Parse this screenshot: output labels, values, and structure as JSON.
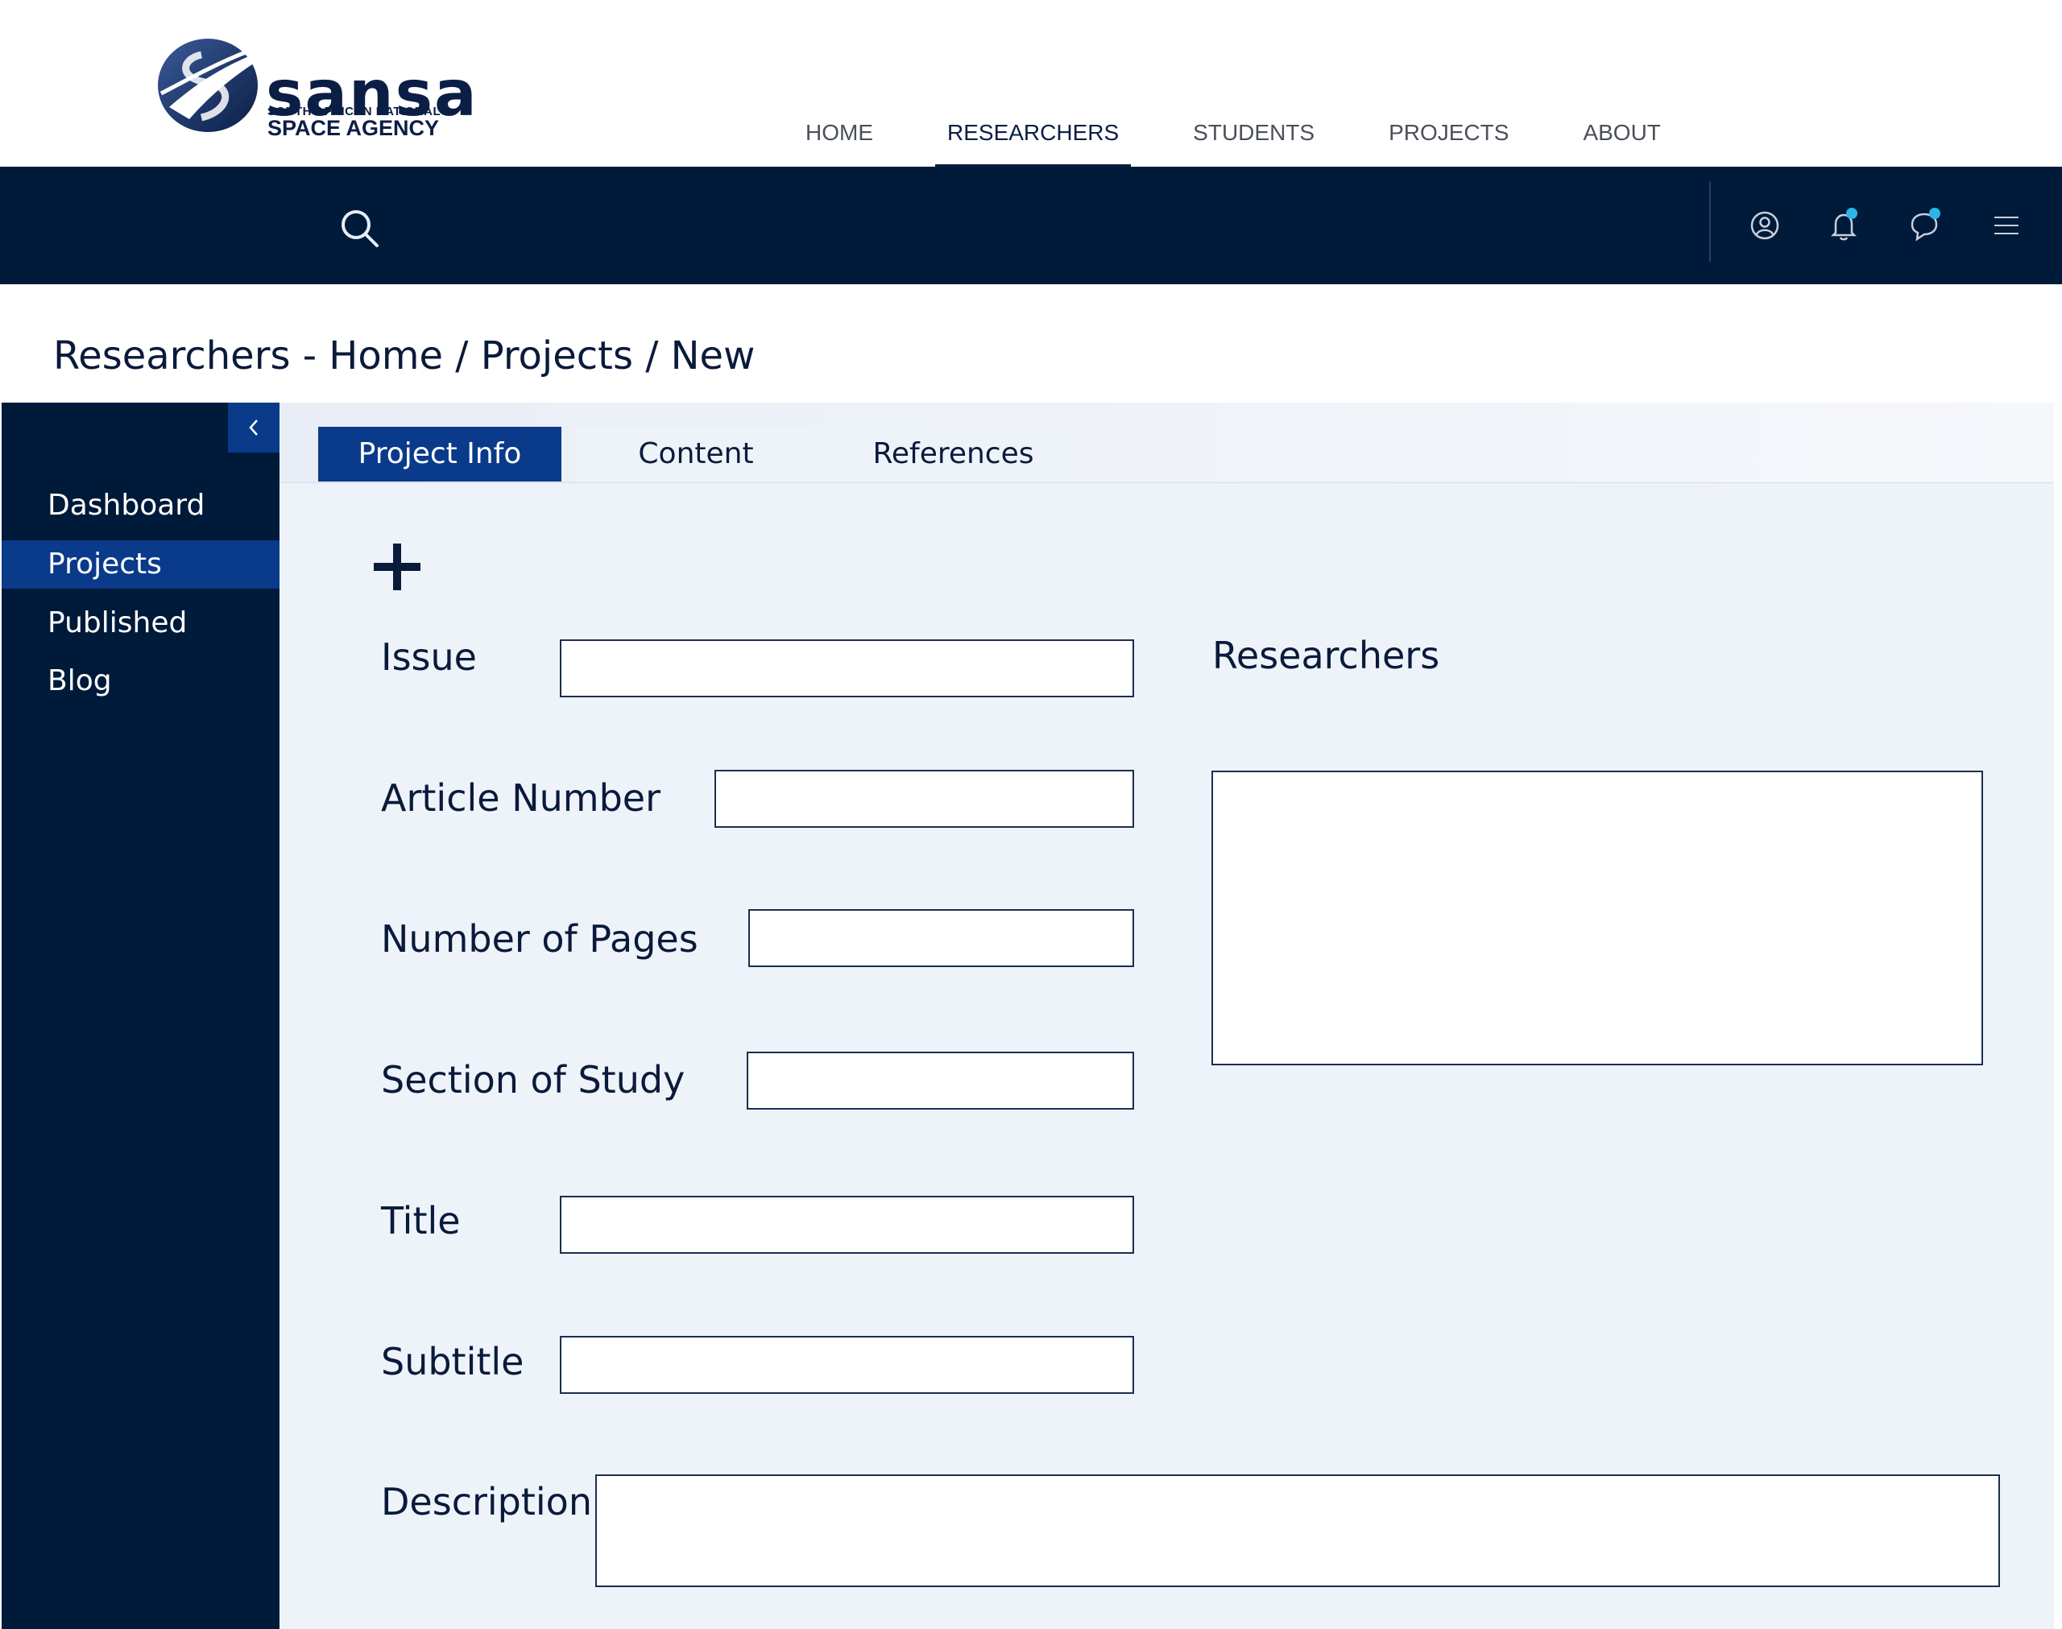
{
  "brand": {
    "wordmark": "sansa",
    "tagline_small": "SOUTH AFRICAN NATIONAL",
    "tagline_large": "SPACE AGENCY",
    "primary_color": "#0b1e45",
    "accent_color": "#2bb5e8"
  },
  "nav": {
    "items": [
      {
        "label": "HOME",
        "active": false
      },
      {
        "label": "RESEARCHERS",
        "active": true
      },
      {
        "label": "STUDENTS",
        "active": false
      },
      {
        "label": "PROJECTS",
        "active": false
      },
      {
        "label": "ABOUT",
        "active": false
      }
    ]
  },
  "toolbar": {
    "background": "#001a3a",
    "search": {
      "value": "",
      "placeholder": ""
    },
    "icons": [
      "user-icon",
      "bell-icon",
      "chat-icon",
      "menu-icon"
    ]
  },
  "page": {
    "title": "Researchers - Home / Projects / New"
  },
  "sidebar": {
    "collapse_icon": "chevron-left-icon",
    "items": [
      {
        "label": "Dashboard",
        "active": false
      },
      {
        "label": "Projects",
        "active": true
      },
      {
        "label": "Published",
        "active": false
      },
      {
        "label": "Blog",
        "active": false
      }
    ]
  },
  "tabs": [
    {
      "label": "Project Info",
      "active": true
    },
    {
      "label": "Content",
      "active": false
    },
    {
      "label": "References",
      "active": false
    }
  ],
  "form": {
    "add_icon": "plus-icon",
    "issue": {
      "label": "Issue",
      "value": ""
    },
    "article_number": {
      "label": "Article Number",
      "value": ""
    },
    "number_of_pages": {
      "label": "Number of Pages",
      "value": ""
    },
    "section_of_study": {
      "label": "Section of Study",
      "value": ""
    },
    "title": {
      "label": "Title",
      "value": ""
    },
    "subtitle": {
      "label": "Subtitle",
      "value": ""
    },
    "description": {
      "label": "Description",
      "value": ""
    },
    "researchers": {
      "label": "Researchers"
    }
  }
}
